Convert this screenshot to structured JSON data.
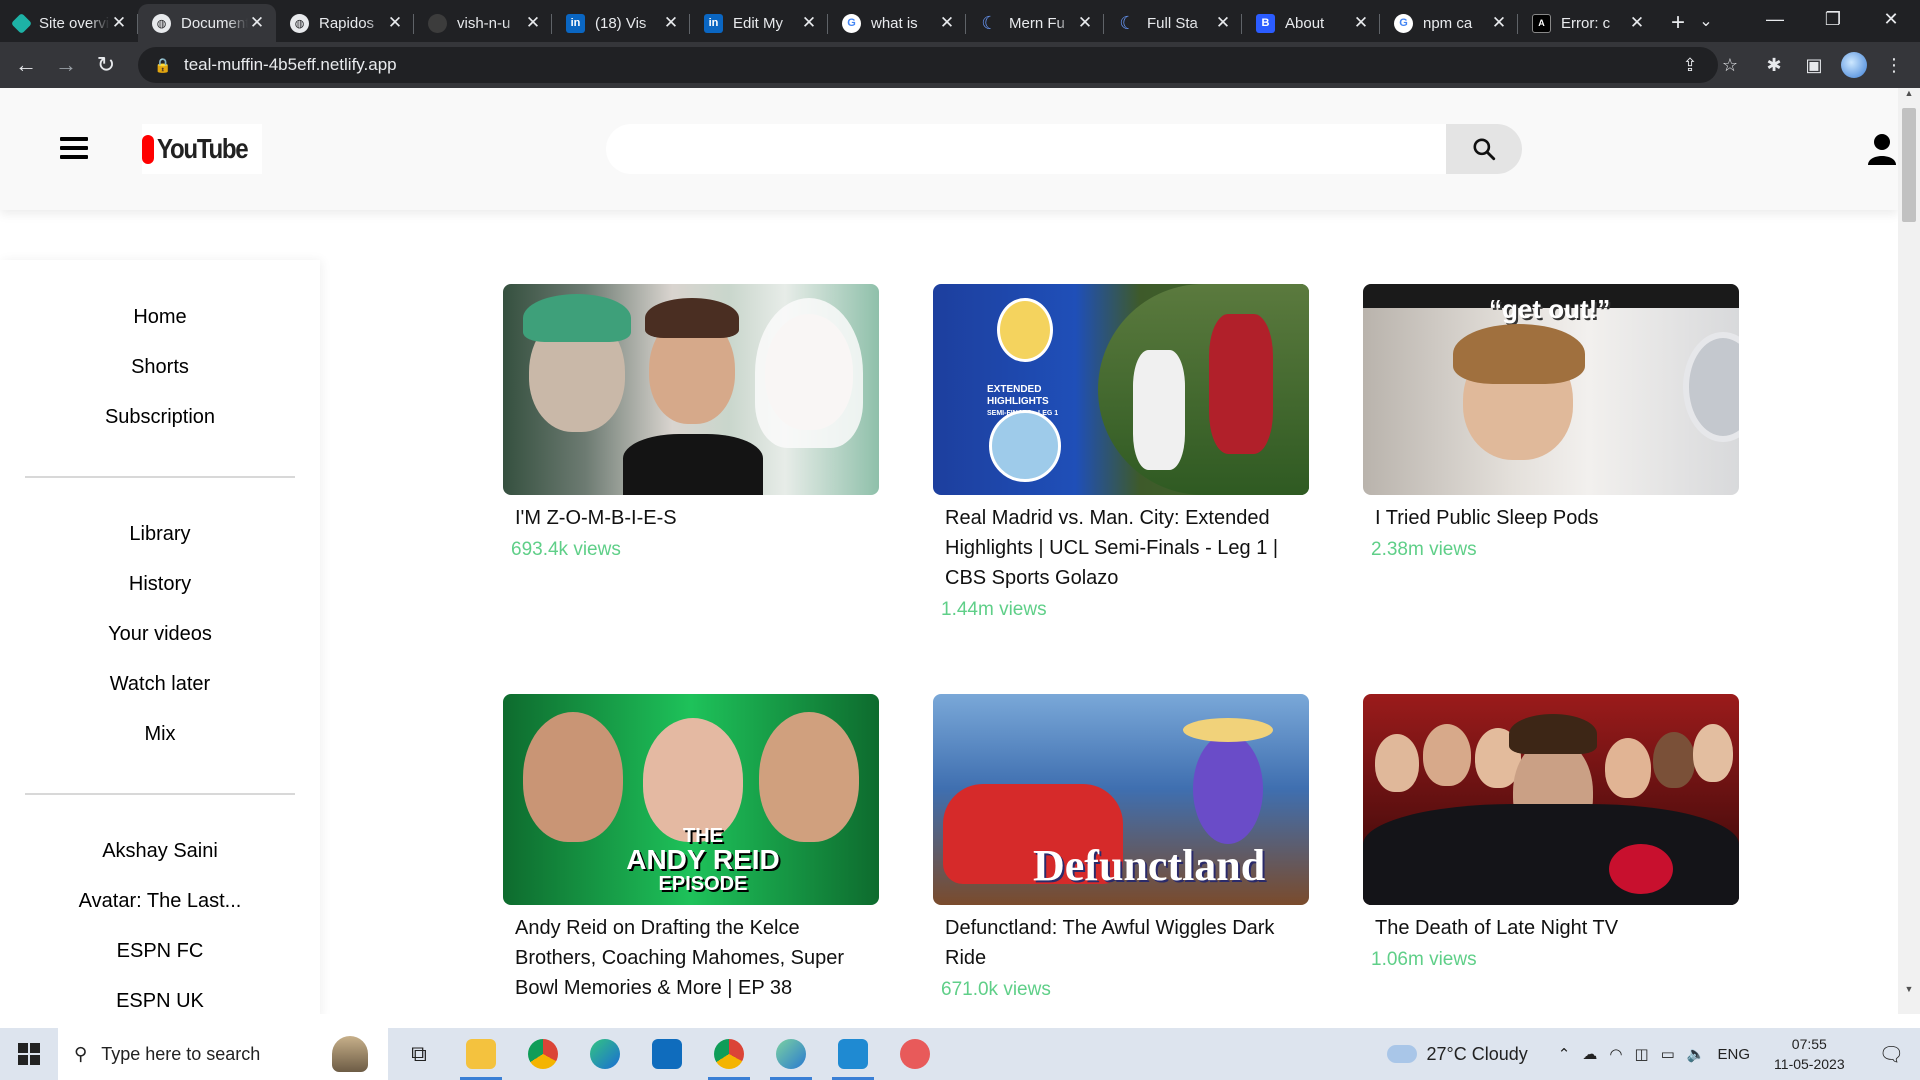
{
  "browser": {
    "tabs": [
      {
        "label": "Site overview",
        "icon": "site-diamond-icon",
        "active": false
      },
      {
        "label": "Document",
        "icon": "globe-icon",
        "active": true
      },
      {
        "label": "Rapidos",
        "icon": "globe-icon",
        "active": false
      },
      {
        "label": "vish-n-u",
        "icon": "github-icon",
        "active": false
      },
      {
        "label": "(18) Vis",
        "icon": "linkedin-icon",
        "active": false
      },
      {
        "label": "Edit My",
        "icon": "linkedin-icon",
        "active": false
      },
      {
        "label": "what is",
        "icon": "google-icon",
        "active": false
      },
      {
        "label": "Mern Fu",
        "icon": "crescent-icon",
        "active": false
      },
      {
        "label": "Full Sta",
        "icon": "crescent-icon",
        "active": false
      },
      {
        "label": "About",
        "icon": "b-icon",
        "active": false
      },
      {
        "label": "npm ca",
        "icon": "google-icon",
        "active": false
      },
      {
        "label": "Error: c",
        "icon": "error-icon",
        "active": false
      }
    ],
    "url": "teal-muffin-4b5eff.netlify.app"
  },
  "header": {
    "logo_text": "YouTube",
    "search_placeholder": "",
    "colors": {
      "logo_red": "#ff0000",
      "header_bg": "#f9f9f9",
      "views_green": "#5fcf88"
    }
  },
  "sidebar": {
    "group1": [
      "Home",
      "Shorts",
      "Subscription"
    ],
    "group2": [
      "Library",
      "History",
      "Your videos",
      "Watch later",
      "Mix"
    ],
    "group3": [
      "Akshay Saini",
      "Avatar: The Last...",
      "ESPN FC",
      "ESPN UK"
    ]
  },
  "videos": [
    {
      "title": "I'M Z-O-M-B-I-E-S",
      "views": "693.4k views"
    },
    {
      "title": "Real Madrid vs. Man. City: Extended Highlights | UCL Semi-Finals - Leg 1 | CBS Sports Golazo",
      "views": "1.44m views"
    },
    {
      "title": "I Tried Public Sleep Pods",
      "views": "2.38m views"
    },
    {
      "title": "Andy Reid on Drafting the Kelce Brothers, Coaching Mahomes, Super Bowl Memories & More | EP 38",
      "views": ""
    },
    {
      "title": "Defunctland: The Awful Wiggles Dark Ride",
      "views": "671.0k views"
    },
    {
      "title": "The Death of Late Night TV",
      "views": "1.06m views"
    }
  ],
  "thumb_text": {
    "t2_line1": "EXTENDED HIGHLIGHTS",
    "t2_line2": "SEMI-FINALS - LEG 1",
    "t3_caption": "“get out!”",
    "t4_line1": "THE",
    "t4_line2": "ANDY REID",
    "t4_line3": "EPISODE",
    "t5_caption": "Defunctland"
  },
  "taskbar": {
    "search_placeholder": "Type here to search",
    "weather": "27°C  Cloudy",
    "language": "ENG",
    "time": "07:55",
    "date": "11-05-2023"
  }
}
